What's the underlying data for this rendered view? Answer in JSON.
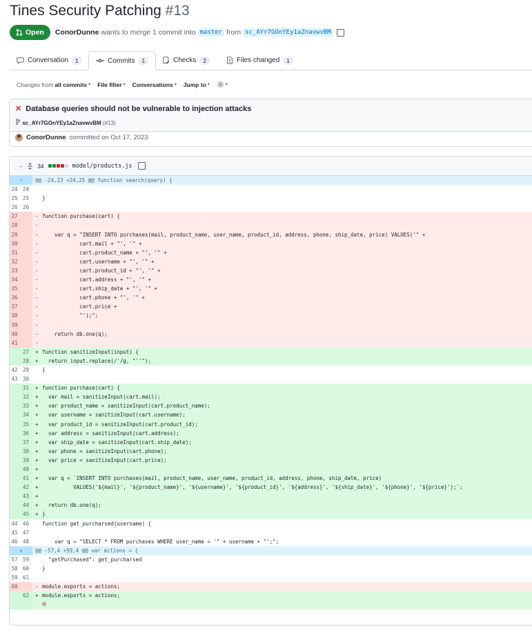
{
  "pr": {
    "title": "Tines Security Patching",
    "number": "#13",
    "state": "Open",
    "author": "ConorDunne",
    "merge_text_1": "wants to merge 1 commit into",
    "base_branch": "master",
    "merge_text_2": "from",
    "head_branch": "sc_AYr7GOnYEy1aZnavwvBM"
  },
  "tabs": [
    {
      "label": "Conversation",
      "count": "1",
      "icon": "comment-icon"
    },
    {
      "label": "Commits",
      "count": "1",
      "icon": "commit-icon"
    },
    {
      "label": "Checks",
      "count": "2",
      "icon": "checklist-icon"
    },
    {
      "label": "Files changed",
      "count": "1",
      "icon": "file-diff-icon"
    }
  ],
  "toolbar": {
    "changes_from_prefix": "Changes from",
    "changes_from_value": "all commits",
    "file_filter": "File filter",
    "conversations": "Conversations",
    "jump_to": "Jump to"
  },
  "commit": {
    "title": "Database queries should not be vulnerable to injection attacks",
    "status": "failed",
    "branch": "sc_AYr7GOnYEy1aZnavwvBM",
    "pr_ref": "(#13)",
    "author": "ConorDunne",
    "committed_text": "committed on Oct 17, 2023"
  },
  "file": {
    "changes": "34",
    "path": "model/products.js",
    "diffstat": [
      "add",
      "add",
      "del",
      "del",
      "n"
    ]
  },
  "diff_lines": [
    {
      "t": "hunk",
      "a": "",
      "b": "",
      "s": "",
      "c": "@@ -24,23 +24,25 @@ function search(query) {"
    },
    {
      "t": "ctx",
      "a": "24",
      "b": "24",
      "s": "",
      "c": ""
    },
    {
      "t": "ctx",
      "a": "25",
      "b": "25",
      "s": "",
      "c": "}"
    },
    {
      "t": "ctx",
      "a": "26",
      "b": "26",
      "s": "",
      "c": ""
    },
    {
      "t": "del",
      "a": "27",
      "b": "",
      "s": "-",
      "c": "function purchase(cart) {"
    },
    {
      "t": "del",
      "a": "28",
      "b": "",
      "s": "-",
      "c": ""
    },
    {
      "t": "del",
      "a": "29",
      "b": "",
      "s": "-",
      "c": "    var q = \"INSERT INTO purchases(mail, product_name, user_name, product_id, address, phone, ship_date, price) VALUES('\" +"
    },
    {
      "t": "del",
      "a": "30",
      "b": "",
      "s": "-",
      "c": "            cart.mail + \"', '\" +"
    },
    {
      "t": "del",
      "a": "31",
      "b": "",
      "s": "-",
      "c": "            cart.product_name + \"', '\" +"
    },
    {
      "t": "del",
      "a": "32",
      "b": "",
      "s": "-",
      "c": "            cart.username + \"', '\" +"
    },
    {
      "t": "del",
      "a": "33",
      "b": "",
      "s": "-",
      "c": "            cart.product_id + \"', '\" +"
    },
    {
      "t": "del",
      "a": "34",
      "b": "",
      "s": "-",
      "c": "            cart.address + \"', '\" +"
    },
    {
      "t": "del",
      "a": "35",
      "b": "",
      "s": "-",
      "c": "            cart.ship_date + \"', '\" +"
    },
    {
      "t": "del",
      "a": "36",
      "b": "",
      "s": "-",
      "c": "            cart.phone + \"', '\" +"
    },
    {
      "t": "del",
      "a": "37",
      "b": "",
      "s": "-",
      "c": "            cart.price +"
    },
    {
      "t": "del",
      "a": "38",
      "b": "",
      "s": "-",
      "c": "            \"');\";"
    },
    {
      "t": "del",
      "a": "39",
      "b": "",
      "s": "-",
      "c": ""
    },
    {
      "t": "del",
      "a": "40",
      "b": "",
      "s": "-",
      "c": "    return db.one(q);"
    },
    {
      "t": "del",
      "a": "41",
      "b": "",
      "s": "-",
      "c": ""
    },
    {
      "t": "add",
      "a": "",
      "b": "27",
      "s": "+",
      "c": "function sanitizeInput(input) {"
    },
    {
      "t": "add",
      "a": "",
      "b": "28",
      "s": "+",
      "c": "  return input.replace(/'/g, \"''\");"
    },
    {
      "t": "ctx",
      "a": "42",
      "b": "29",
      "s": "",
      "c": "}"
    },
    {
      "t": "ctx",
      "a": "43",
      "b": "30",
      "s": "",
      "c": ""
    },
    {
      "t": "add",
      "a": "",
      "b": "31",
      "s": "+",
      "c": "function purchase(cart) {"
    },
    {
      "t": "add",
      "a": "",
      "b": "32",
      "s": "+",
      "c": "  var mail = sanitizeInput(cart.mail);"
    },
    {
      "t": "add",
      "a": "",
      "b": "33",
      "s": "+",
      "c": "  var product_name = sanitizeInput(cart.product_name);"
    },
    {
      "t": "add",
      "a": "",
      "b": "34",
      "s": "+",
      "c": "  var username = sanitizeInput(cart.username);"
    },
    {
      "t": "add",
      "a": "",
      "b": "35",
      "s": "+",
      "c": "  var product_id = sanitizeInput(cart.product_id);"
    },
    {
      "t": "add",
      "a": "",
      "b": "36",
      "s": "+",
      "c": "  var address = sanitizeInput(cart.address);"
    },
    {
      "t": "add",
      "a": "",
      "b": "37",
      "s": "+",
      "c": "  var ship_date = sanitizeInput(cart.ship_date);"
    },
    {
      "t": "add",
      "a": "",
      "b": "38",
      "s": "+",
      "c": "  var phone = sanitizeInput(cart.phone);"
    },
    {
      "t": "add",
      "a": "",
      "b": "39",
      "s": "+",
      "c": "  var price = sanitizeInput(cart.price);"
    },
    {
      "t": "add",
      "a": "",
      "b": "40",
      "s": "+",
      "c": ""
    },
    {
      "t": "add",
      "a": "",
      "b": "41",
      "s": "+",
      "c": "  var q = `INSERT INTO purchases(mail, product_name, user_name, product_id, address, phone, ship_date, price)"
    },
    {
      "t": "add",
      "a": "",
      "b": "42",
      "s": "+",
      "c": "          VALUES('${mail}', '${product_name}', '${username}', '${product_id}', '${address}', '${ship_date}', '${phone}', '${price}');`;"
    },
    {
      "t": "add",
      "a": "",
      "b": "43",
      "s": "+",
      "c": ""
    },
    {
      "t": "add",
      "a": "",
      "b": "44",
      "s": "+",
      "c": "  return db.one(q);"
    },
    {
      "t": "add",
      "a": "",
      "b": "45",
      "s": "+",
      "c": "}"
    },
    {
      "t": "ctx",
      "a": "44",
      "b": "46",
      "s": "",
      "c": "function get_purcharsed(username) {"
    },
    {
      "t": "ctx",
      "a": "45",
      "b": "47",
      "s": "",
      "c": ""
    },
    {
      "t": "ctx",
      "a": "46",
      "b": "48",
      "s": "",
      "c": "    var q = \"SELECT * FROM purchases WHERE user_name = '\" + username + \"';\";"
    },
    {
      "t": "hunk",
      "a": "",
      "b": "",
      "s": "",
      "c": "@@ -57,4 +59,4 @@ var actions = {"
    },
    {
      "t": "ctx",
      "a": "57",
      "b": "59",
      "s": "",
      "c": "  \"getPurchased\": get_purcharsed"
    },
    {
      "t": "ctx",
      "a": "58",
      "b": "60",
      "s": "",
      "c": "}"
    },
    {
      "t": "ctx",
      "a": "59",
      "b": "61",
      "s": "",
      "c": ""
    },
    {
      "t": "del",
      "a": "60",
      "b": "",
      "s": "-",
      "c": "module.exports = actions;"
    },
    {
      "t": "add",
      "a": "",
      "b": "62",
      "s": "+",
      "c": "module.exports = actions;"
    },
    {
      "t": "add",
      "a": "",
      "b": "",
      "s": "",
      "c": "",
      "noeol": true
    }
  ]
}
